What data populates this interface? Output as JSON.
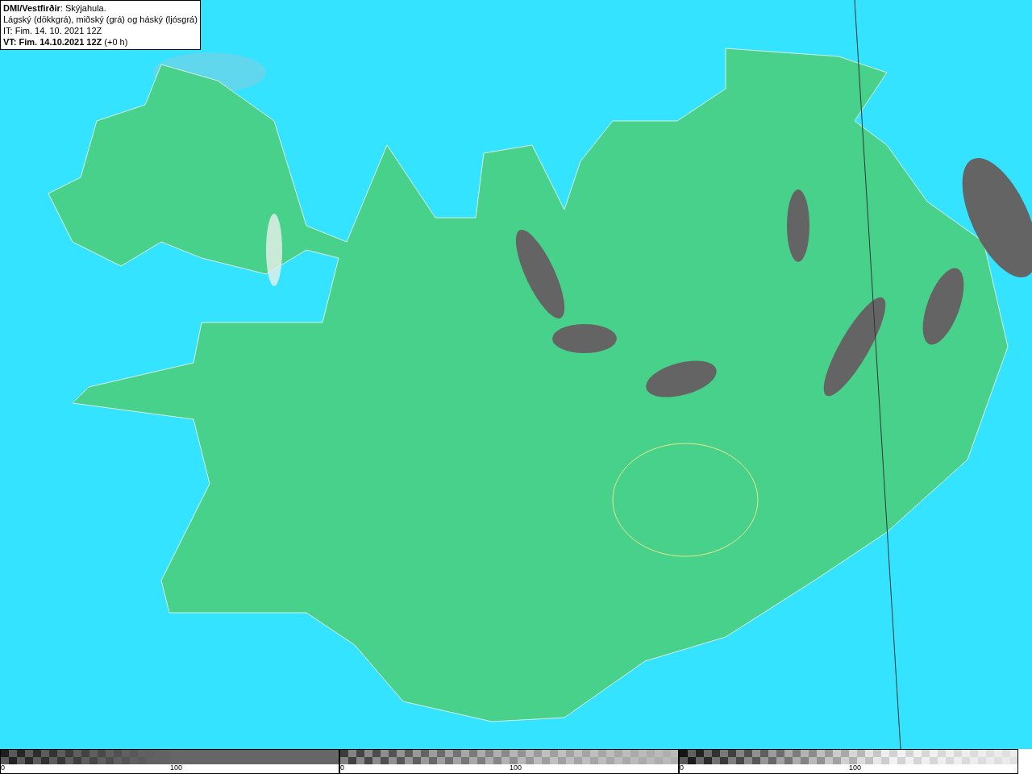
{
  "legend": {
    "lines": [
      "**DMI/Vestfirðir**: Skýjahula.",
      "Lágský (dökkgrá), miðský (grá) og háský (ljósgrá)",
      "IT: Fim. 14. 10. 2021 12Z",
      "**VT: Fim. 14.10.2021 12Z** (+0 h)"
    ]
  },
  "scales": [
    {
      "kind": "low",
      "labels": [
        "0",
        "100"
      ]
    },
    {
      "kind": "mid",
      "labels": [
        "0",
        "100"
      ]
    },
    {
      "kind": "high",
      "labels": [
        "0",
        "100"
      ]
    }
  ]
}
